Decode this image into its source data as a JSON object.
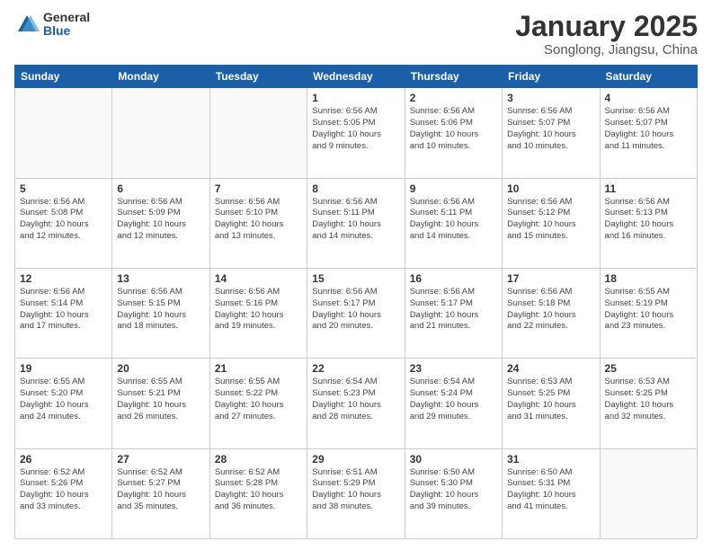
{
  "header": {
    "logo_general": "General",
    "logo_blue": "Blue",
    "title": "January 2025",
    "subtitle": "Songlong, Jiangsu, China"
  },
  "weekdays": [
    "Sunday",
    "Monday",
    "Tuesday",
    "Wednesday",
    "Thursday",
    "Friday",
    "Saturday"
  ],
  "weeks": [
    [
      {
        "day": "",
        "info": ""
      },
      {
        "day": "",
        "info": ""
      },
      {
        "day": "",
        "info": ""
      },
      {
        "day": "1",
        "info": "Sunrise: 6:56 AM\nSunset: 5:05 PM\nDaylight: 10 hours\nand 9 minutes."
      },
      {
        "day": "2",
        "info": "Sunrise: 6:56 AM\nSunset: 5:06 PM\nDaylight: 10 hours\nand 10 minutes."
      },
      {
        "day": "3",
        "info": "Sunrise: 6:56 AM\nSunset: 5:07 PM\nDaylight: 10 hours\nand 10 minutes."
      },
      {
        "day": "4",
        "info": "Sunrise: 6:56 AM\nSunset: 5:07 PM\nDaylight: 10 hours\nand 11 minutes."
      }
    ],
    [
      {
        "day": "5",
        "info": "Sunrise: 6:56 AM\nSunset: 5:08 PM\nDaylight: 10 hours\nand 12 minutes."
      },
      {
        "day": "6",
        "info": "Sunrise: 6:56 AM\nSunset: 5:09 PM\nDaylight: 10 hours\nand 12 minutes."
      },
      {
        "day": "7",
        "info": "Sunrise: 6:56 AM\nSunset: 5:10 PM\nDaylight: 10 hours\nand 13 minutes."
      },
      {
        "day": "8",
        "info": "Sunrise: 6:56 AM\nSunset: 5:11 PM\nDaylight: 10 hours\nand 14 minutes."
      },
      {
        "day": "9",
        "info": "Sunrise: 6:56 AM\nSunset: 5:11 PM\nDaylight: 10 hours\nand 14 minutes."
      },
      {
        "day": "10",
        "info": "Sunrise: 6:56 AM\nSunset: 5:12 PM\nDaylight: 10 hours\nand 15 minutes."
      },
      {
        "day": "11",
        "info": "Sunrise: 6:56 AM\nSunset: 5:13 PM\nDaylight: 10 hours\nand 16 minutes."
      }
    ],
    [
      {
        "day": "12",
        "info": "Sunrise: 6:56 AM\nSunset: 5:14 PM\nDaylight: 10 hours\nand 17 minutes."
      },
      {
        "day": "13",
        "info": "Sunrise: 6:56 AM\nSunset: 5:15 PM\nDaylight: 10 hours\nand 18 minutes."
      },
      {
        "day": "14",
        "info": "Sunrise: 6:56 AM\nSunset: 5:16 PM\nDaylight: 10 hours\nand 19 minutes."
      },
      {
        "day": "15",
        "info": "Sunrise: 6:56 AM\nSunset: 5:17 PM\nDaylight: 10 hours\nand 20 minutes."
      },
      {
        "day": "16",
        "info": "Sunrise: 6:56 AM\nSunset: 5:17 PM\nDaylight: 10 hours\nand 21 minutes."
      },
      {
        "day": "17",
        "info": "Sunrise: 6:56 AM\nSunset: 5:18 PM\nDaylight: 10 hours\nand 22 minutes."
      },
      {
        "day": "18",
        "info": "Sunrise: 6:55 AM\nSunset: 5:19 PM\nDaylight: 10 hours\nand 23 minutes."
      }
    ],
    [
      {
        "day": "19",
        "info": "Sunrise: 6:55 AM\nSunset: 5:20 PM\nDaylight: 10 hours\nand 24 minutes."
      },
      {
        "day": "20",
        "info": "Sunrise: 6:55 AM\nSunset: 5:21 PM\nDaylight: 10 hours\nand 26 minutes."
      },
      {
        "day": "21",
        "info": "Sunrise: 6:55 AM\nSunset: 5:22 PM\nDaylight: 10 hours\nand 27 minutes."
      },
      {
        "day": "22",
        "info": "Sunrise: 6:54 AM\nSunset: 5:23 PM\nDaylight: 10 hours\nand 28 minutes."
      },
      {
        "day": "23",
        "info": "Sunrise: 6:54 AM\nSunset: 5:24 PM\nDaylight: 10 hours\nand 29 minutes."
      },
      {
        "day": "24",
        "info": "Sunrise: 6:53 AM\nSunset: 5:25 PM\nDaylight: 10 hours\nand 31 minutes."
      },
      {
        "day": "25",
        "info": "Sunrise: 6:53 AM\nSunset: 5:25 PM\nDaylight: 10 hours\nand 32 minutes."
      }
    ],
    [
      {
        "day": "26",
        "info": "Sunrise: 6:52 AM\nSunset: 5:26 PM\nDaylight: 10 hours\nand 33 minutes."
      },
      {
        "day": "27",
        "info": "Sunrise: 6:52 AM\nSunset: 5:27 PM\nDaylight: 10 hours\nand 35 minutes."
      },
      {
        "day": "28",
        "info": "Sunrise: 6:52 AM\nSunset: 5:28 PM\nDaylight: 10 hours\nand 36 minutes."
      },
      {
        "day": "29",
        "info": "Sunrise: 6:51 AM\nSunset: 5:29 PM\nDaylight: 10 hours\nand 38 minutes."
      },
      {
        "day": "30",
        "info": "Sunrise: 6:50 AM\nSunset: 5:30 PM\nDaylight: 10 hours\nand 39 minutes."
      },
      {
        "day": "31",
        "info": "Sunrise: 6:50 AM\nSunset: 5:31 PM\nDaylight: 10 hours\nand 41 minutes."
      },
      {
        "day": "",
        "info": ""
      }
    ]
  ]
}
